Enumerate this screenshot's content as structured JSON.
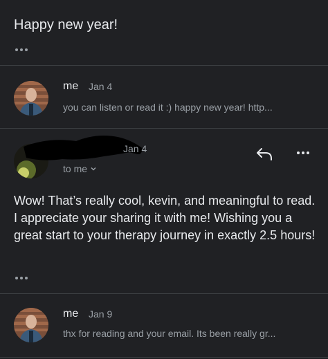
{
  "top_message": {
    "body": "Happy new year!"
  },
  "thread": [
    {
      "sender": "me",
      "date": "Jan 4",
      "snippet": "you can listen or read it :) happy new year! http..."
    },
    {
      "sender": "me",
      "date": "Jan 9",
      "snippet": "thx for reading and your email. Its been really gr..."
    }
  ],
  "expanded": {
    "date": "Jan 4",
    "recipient": "to me",
    "body": "Wow! That’s really cool, kevin, and meaningful to read. I appreciate your sharing it with me! Wishing you a great start to your therapy journey in exactly 2.5 hours!"
  },
  "icons": {
    "reply": "reply-icon",
    "more": "more-vertical-icon",
    "expand": "chevron-down-icon",
    "ellipsis": "ellipsis-icon"
  },
  "colors": {
    "background": "#202124",
    "text": "#e8eaed",
    "muted": "#9aa0a6",
    "divider": "#3c4043"
  }
}
